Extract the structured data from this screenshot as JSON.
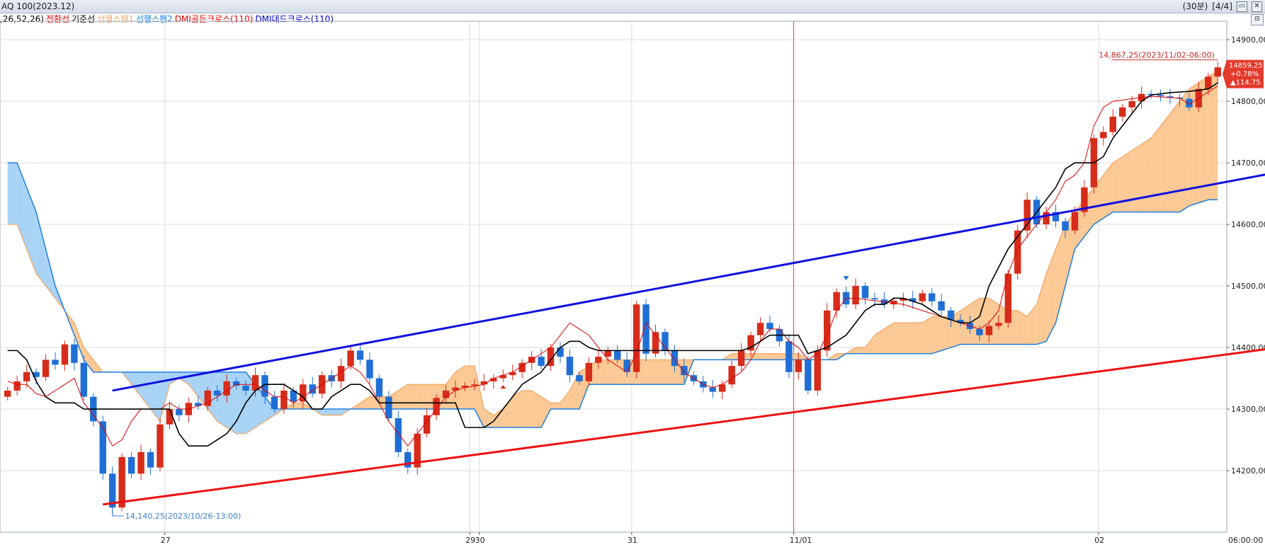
{
  "window": {
    "title": "AQ 100(2023.12)",
    "period": "(30분)",
    "page": "[4/4]"
  },
  "legend": [
    {
      "text": ",26,52,26)",
      "color": "#000000"
    },
    {
      "text": "전환선",
      "color": "#e00000"
    },
    {
      "text": "기준선",
      "color": "#000000"
    },
    {
      "text": "선행스팬1",
      "color": "#f4a460"
    },
    {
      "text": "선행스팬2",
      "color": "#1e7fe0"
    },
    {
      "text": "DMI골든크로스(110)",
      "color": "#e00000"
    },
    {
      "text": "DMI데드크로스(110)",
      "color": "#0000cc"
    }
  ],
  "colors": {
    "up": "#d62c1a",
    "down": "#1f6fd6",
    "tenkan": "#e00000",
    "kijun": "#000000",
    "span1": "#f4a460",
    "span2": "#1e7fe0",
    "cloud_bull": "#fbc995",
    "cloud_bear": "#a8d3f5",
    "upper_trend": "#1010e0",
    "lower_trend": "#ee1010",
    "highlight": "#22aa33",
    "divider": "#ee4444"
  },
  "chart_data": {
    "type": "candlestick",
    "x": [
      "26",
      "26",
      "26",
      "26",
      "26",
      "26",
      "26",
      "26",
      "26",
      "26",
      "26",
      "26",
      "26",
      "26",
      "26",
      "26",
      "26",
      "27",
      "27",
      "27",
      "27",
      "27",
      "27",
      "27",
      "27",
      "27",
      "27",
      "27",
      "27",
      "27",
      "27",
      "27",
      "27",
      "28",
      "28",
      "28",
      "28",
      "28",
      "28",
      "28",
      "28",
      "28",
      "28",
      "28",
      "28",
      "28",
      "28",
      "28",
      "28",
      "29",
      "30",
      "30",
      "30",
      "30",
      "30",
      "30",
      "30",
      "30",
      "30",
      "30",
      "30",
      "30",
      "30",
      "30",
      "30",
      "30",
      "31",
      "31",
      "31",
      "31",
      "31",
      "31",
      "31",
      "31",
      "31",
      "31",
      "31",
      "31",
      "31",
      "31",
      "31",
      "31",
      "31",
      "11/01",
      "11/01",
      "11/01",
      "11/01",
      "11/01",
      "11/01",
      "11/01",
      "11/01",
      "11/01",
      "11/01",
      "11/01",
      "11/01",
      "11/01",
      "11/01",
      "11/01",
      "11/01",
      "11/01",
      "11/01",
      "11/01",
      "11/01",
      "11/01",
      "11/01",
      "11/01",
      "11/01",
      "11/01",
      "11/01",
      "11/01",
      "11/01",
      "11/01",
      "11/01",
      "11/01",
      "11/01",
      "02",
      "02",
      "02",
      "02",
      "02",
      "02",
      "02",
      "02",
      "02",
      "02",
      "02",
      "02"
    ],
    "close": [
      14330,
      14345,
      14360,
      14352,
      14380,
      14372,
      14405,
      14375,
      14320,
      14280,
      14195,
      14140,
      14222,
      14195,
      14230,
      14205,
      14275,
      14300,
      14290,
      14310,
      14305,
      14330,
      14322,
      14345,
      14338,
      14330,
      14355,
      14320,
      14300,
      14330,
      14312,
      14340,
      14325,
      14355,
      14345,
      14370,
      14395,
      14380,
      14350,
      14320,
      14285,
      14230,
      14205,
      14260,
      14290,
      14318,
      14330,
      14335,
      14338,
      14340,
      14345,
      14350,
      14355,
      14360,
      14375,
      14385,
      14370,
      14400,
      14385,
      14355,
      14345,
      14375,
      14385,
      14395,
      14380,
      14360,
      14470,
      14390,
      14425,
      14395,
      14370,
      14355,
      14345,
      14335,
      14328,
      14340,
      14370,
      14395,
      14420,
      14440,
      14430,
      14410,
      14360,
      14380,
      14330,
      14395,
      14460,
      14490,
      14470,
      14500,
      14480,
      14478,
      14470,
      14476,
      14480,
      14475,
      14488,
      14475,
      14460,
      14445,
      14440,
      14430,
      14420,
      14435,
      14440,
      14520,
      14590,
      14640,
      14600,
      14620,
      14605,
      14590,
      14620,
      14660,
      14740,
      14750,
      14775,
      14790,
      14800,
      14812,
      14810,
      14808,
      14806,
      14804,
      14790,
      14820,
      14840,
      14855
    ],
    "open_close_color": "up-red / down-blue",
    "tenkan": [
      14345,
      14340,
      14340,
      14325,
      14320,
      14330,
      14340,
      14350,
      14310,
      14290,
      14270,
      14240,
      14250,
      14280,
      14300,
      14300,
      14300,
      14310,
      14300,
      14300,
      14305,
      14310,
      14320,
      14330,
      14340,
      14340,
      14340,
      14330,
      14320,
      14320,
      14310,
      14320,
      14330,
      14340,
      14350,
      14360,
      14370,
      14360,
      14340,
      14310,
      14280,
      14260,
      14240,
      14260,
      14280,
      14300,
      14320,
      14330,
      14335,
      14337,
      14340,
      14350,
      14355,
      14360,
      14370,
      14380,
      14390,
      14400,
      14420,
      14440,
      14430,
      14420,
      14400,
      14380,
      14370,
      14360,
      14390,
      14440,
      14420,
      14400,
      14380,
      14360,
      14350,
      14340,
      14335,
      14340,
      14350,
      14360,
      14380,
      14410,
      14430,
      14430,
      14410,
      14400,
      14380,
      14390,
      14420,
      14460,
      14480,
      14480,
      14478,
      14476,
      14474,
      14472,
      14470,
      14465,
      14460,
      14455,
      14450,
      14445,
      14440,
      14435,
      14430,
      14440,
      14460,
      14520,
      14560,
      14580,
      14600,
      14620,
      14640,
      14670,
      14680,
      14700,
      14760,
      14790,
      14800,
      14802,
      14804,
      14806,
      14808,
      14807,
      14806,
      14805,
      14795,
      14805,
      14815,
      14825
    ],
    "kijun": [
      14395,
      14395,
      14380,
      14345,
      14320,
      14310,
      14310,
      14310,
      14300,
      14300,
      14300,
      14300,
      14300,
      14300,
      14300,
      14300,
      14300,
      14300,
      14260,
      14240,
      14240,
      14240,
      14250,
      14260,
      14280,
      14310,
      14330,
      14340,
      14340,
      14340,
      14330,
      14320,
      14300,
      14300,
      14320,
      14330,
      14340,
      14340,
      14330,
      14310,
      14310,
      14310,
      14310,
      14310,
      14310,
      14310,
      14310,
      14310,
      14270,
      14270,
      14270,
      14280,
      14300,
      14320,
      14340,
      14350,
      14360,
      14380,
      14400,
      14410,
      14410,
      14400,
      14395,
      14395,
      14395,
      14395,
      14395,
      14395,
      14395,
      14395,
      14395,
      14395,
      14395,
      14395,
      14395,
      14395,
      14395,
      14395,
      14400,
      14410,
      14420,
      14420,
      14420,
      14420,
      14390,
      14395,
      14400,
      14410,
      14420,
      14440,
      14460,
      14470,
      14470,
      14480,
      14480,
      14475,
      14470,
      14460,
      14450,
      14445,
      14440,
      14440,
      14450,
      14500,
      14530,
      14560,
      14580,
      14600,
      14620,
      14640,
      14660,
      14690,
      14700,
      14700,
      14700,
      14710,
      14740,
      14760,
      14780,
      14800,
      14810,
      14812,
      14814,
      14815,
      14816,
      14818,
      14820,
      14830
    ],
    "span1": [
      14600,
      14600,
      14560,
      14520,
      14500,
      14480,
      14460,
      14440,
      14400,
      14380,
      14360,
      14360,
      14360,
      14340,
      14320,
      14300,
      14280,
      14340,
      14350,
      14340,
      14320,
      14300,
      14280,
      14270,
      14260,
      14260,
      14270,
      14280,
      14290,
      14300,
      14310,
      14310,
      14300,
      14290,
      14290,
      14290,
      14300,
      14310,
      14320,
      14320,
      14320,
      14330,
      14340,
      14340,
      14340,
      14340,
      14340,
      14360,
      14370,
      14370,
      14300,
      14290,
      14300,
      14320,
      14330,
      14330,
      14320,
      14310,
      14310,
      14330,
      14360,
      14370,
      14380,
      14380,
      14380,
      14380,
      14380,
      14380,
      14380,
      14380,
      14380,
      14380,
      14380,
      14380,
      14380,
      14380,
      14390,
      14390,
      14390,
      14390,
      14390,
      14390,
      14390,
      14390,
      14380,
      14380,
      14380,
      14390,
      14390,
      14400,
      14400,
      14420,
      14430,
      14440,
      14440,
      14440,
      14440,
      14450,
      14450,
      14450,
      14460,
      14470,
      14480,
      14480,
      14470,
      14460,
      14460,
      14450,
      14470,
      14520,
      14560,
      14600,
      14620,
      14640,
      14660,
      14680,
      14700,
      14710,
      14720,
      14730,
      14740,
      14760,
      14780,
      14800,
      14820,
      14830,
      14840,
      14850
    ],
    "span2": [
      14700,
      14700,
      14660,
      14620,
      14560,
      14500,
      14460,
      14420,
      14380,
      14360,
      14360,
      14360,
      14360,
      14360,
      14360,
      14360,
      14360,
      14360,
      14360,
      14360,
      14360,
      14360,
      14360,
      14360,
      14360,
      14360,
      14340,
      14320,
      14300,
      14300,
      14300,
      14300,
      14300,
      14300,
      14300,
      14300,
      14300,
      14300,
      14300,
      14300,
      14300,
      14300,
      14300,
      14300,
      14300,
      14300,
      14300,
      14300,
      14300,
      14300,
      14270,
      14270,
      14270,
      14270,
      14270,
      14270,
      14270,
      14300,
      14300,
      14300,
      14300,
      14340,
      14340,
      14340,
      14340,
      14340,
      14340,
      14340,
      14340,
      14340,
      14340,
      14340,
      14380,
      14380,
      14380,
      14380,
      14380,
      14380,
      14380,
      14380,
      14380,
      14380,
      14380,
      14380,
      14380,
      14380,
      14380,
      14380,
      14390,
      14390,
      14390,
      14390,
      14390,
      14390,
      14390,
      14390,
      14390,
      14390,
      14395,
      14400,
      14405,
      14405,
      14405,
      14405,
      14405,
      14405,
      14405,
      14405,
      14405,
      14410,
      14440,
      14500,
      14560,
      14580,
      14600,
      14610,
      14620,
      14620,
      14620,
      14620,
      14620,
      14620,
      14620,
      14620,
      14630,
      14635,
      14640,
      14640
    ],
    "y_ticks": [
      "14900,00",
      "14800,00",
      "14700,00",
      "14600,00",
      "14500,00",
      "14400,00",
      "14300,00",
      "14200,00"
    ],
    "y_tick_values": [
      14900,
      14800,
      14700,
      14600,
      14500,
      14400,
      14300,
      14200
    ],
    "x_ticks": [
      "27",
      "29",
      "30",
      "31",
      "11/01",
      "02"
    ],
    "time_label": "06:00:00",
    "ylim": [
      14100,
      14930
    ],
    "annotations": {
      "high": "14,867,25(2023/11/02-06:00)",
      "high_value": 14867.25,
      "low": "14,140,25(2023/10/26-13:00)",
      "low_value": 14140.25,
      "last_price": "14859,25",
      "change_pct": "+0.78%",
      "change_abs": "▲114.75",
      "golden_cross_index": 52,
      "dead_cross_index": 88
    },
    "trendlines": {
      "upper": {
        "from_index": 11,
        "from_value": 14330,
        "to_index": 161,
        "to_value": 14765
      },
      "lower": {
        "from_index": 10,
        "from_value": 14145,
        "to_index": 161,
        "to_value": 14457
      }
    },
    "grid": true
  }
}
